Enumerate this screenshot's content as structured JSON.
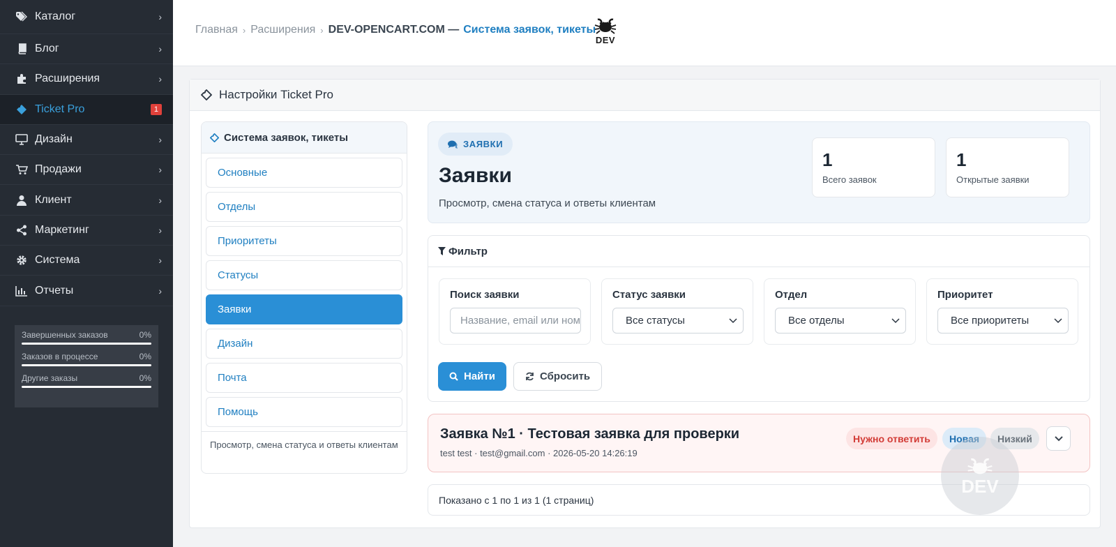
{
  "sidebar": {
    "items": [
      {
        "label": "Каталог",
        "icon": "tags-icon"
      },
      {
        "label": "Блог",
        "icon": "book-icon"
      },
      {
        "label": "Расширения",
        "icon": "puzzle-icon"
      },
      {
        "label": "Ticket Pro",
        "icon": "ticket-icon",
        "badge": "1",
        "active": true
      },
      {
        "label": "Дизайн",
        "icon": "desktop-icon"
      },
      {
        "label": "Продажи",
        "icon": "cart-icon"
      },
      {
        "label": "Клиент",
        "icon": "user-icon"
      },
      {
        "label": "Маркетинг",
        "icon": "share-icon"
      },
      {
        "label": "Система",
        "icon": "gear-icon"
      },
      {
        "label": "Отчеты",
        "icon": "bar-chart-icon"
      }
    ],
    "stats": [
      {
        "label": "Завершенных заказов",
        "value": "0%",
        "progress": 0
      },
      {
        "label": "Заказов в процессе",
        "value": "0%",
        "progress": 0
      },
      {
        "label": "Другие заказы",
        "value": "0%",
        "progress": 0
      }
    ]
  },
  "breadcrumb": {
    "home": "Главная",
    "extensions": "Расширения",
    "current_prefix": "DEV-OPENCART.COM —",
    "current_accent": "Система заявок, тикеты"
  },
  "logo": {
    "text": "DEV"
  },
  "card": {
    "title": "Настройки Ticket Pro"
  },
  "menu": {
    "title": "Система заявок, тикеты",
    "items": [
      "Основные",
      "Отделы",
      "Приоритеты",
      "Статусы",
      "Заявки",
      "Дизайн",
      "Почта",
      "Помощь"
    ],
    "active_index": 4,
    "footer": "Просмотр, смена статуса и ответы клиентам"
  },
  "hero": {
    "pill": "ЗАЯВКИ",
    "title": "Заявки",
    "subtitle": "Просмотр, смена статуса и ответы клиентам",
    "kpis": [
      {
        "value": "1",
        "label": "Всего заявок"
      },
      {
        "value": "1",
        "label": "Открытые заявки"
      }
    ]
  },
  "filter": {
    "title": "Фильтр",
    "search": {
      "label": "Поиск заявки",
      "placeholder": "Название, email или номер"
    },
    "status": {
      "label": "Статус заявки",
      "value": "Все статусы"
    },
    "department": {
      "label": "Отдел",
      "value": "Все отделы"
    },
    "priority": {
      "label": "Приоритет",
      "value": "Все приоритеты"
    },
    "find_label": "Найти",
    "reset_label": "Сбросить"
  },
  "ticket": {
    "title": "Заявка №1 · Тестовая заявка для проверки",
    "meta": "test test · test@gmail.com · 2026-05-20 14:26:19",
    "badges": {
      "reply": "Нужно ответить",
      "status": "Новая",
      "priority": "Низкий"
    }
  },
  "pagination": {
    "text": "Показано с 1 по 1 из 1 (1 страниц)"
  },
  "watermark": {
    "text": "DEV"
  },
  "colors": {
    "accent": "#2a8fd6",
    "sidebar_bg": "#262c34",
    "danger": "#d23b36"
  }
}
